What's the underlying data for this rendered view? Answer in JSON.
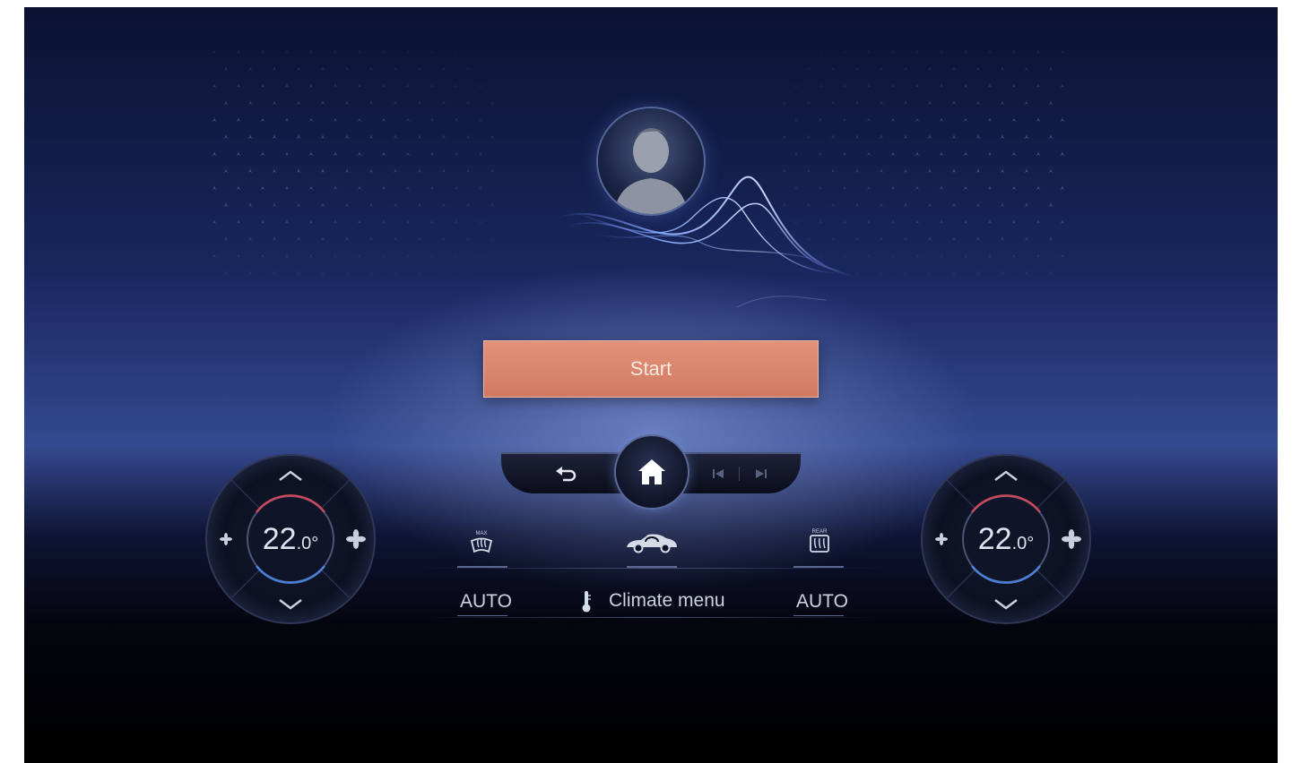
{
  "profile": {
    "start_label": "Start"
  },
  "dock": {
    "home_icon": "home-icon",
    "back_icon": "back-arrow-icon",
    "prev_icon": "skip-previous-icon",
    "next_icon": "skip-next-icon"
  },
  "climate": {
    "left": {
      "temp_whole": "22",
      "temp_decimal": ".0",
      "unit": "°"
    },
    "right": {
      "temp_whole": "22",
      "temp_decimal": ".0",
      "unit": "°"
    },
    "front_defrost_label": "MAX",
    "rear_defrost_label": "REAR",
    "left_mode": "AUTO",
    "right_mode": "AUTO",
    "menu_label": "Climate menu"
  },
  "colors": {
    "accent": "#d88a72",
    "glow": "#7f9fff"
  }
}
